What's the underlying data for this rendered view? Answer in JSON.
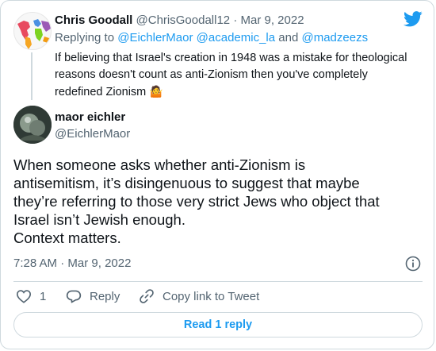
{
  "parent_tweet": {
    "author_name": "Chris Goodall",
    "author_handle": "@ChrisGoodall12",
    "separator": "·",
    "date": "Mar 9, 2022",
    "replying_prefix": "Replying to",
    "reply_to_1": "@EichlerMaor",
    "reply_to_2": "@academic_la",
    "reply_and": "and",
    "reply_to_3": "@madzeezs",
    "text_line_1": "If believing that Israel's creation in 1948 was a mistake for theological",
    "text_line_2": "reasons doesn't count as anti-Zionism then you've completely",
    "text_line_3": "redefined Zionism",
    "emoji": "🤷",
    "emoji_icon": "person-shrugging-icon"
  },
  "main_tweet": {
    "author_name": "maor eichler",
    "author_handle": "@EichlerMaor",
    "text_lines": [
      "When someone asks whether anti-Zionism is",
      "antisemitism, it’s disingenuous to suggest that maybe",
      "they’re referring to those very strict Jews who object that",
      "Israel isn’t Jewish enough.",
      "Context matters."
    ],
    "time": "7:28 AM",
    "separator": "·",
    "date": "Mar 9, 2022"
  },
  "actions": {
    "like_count": "1",
    "reply_label": "Reply",
    "copy_link_label": "Copy link to Tweet"
  },
  "read_replies_label": "Read 1 reply",
  "colors": {
    "twitter_blue": "#1d9bf0",
    "muted_text": "#536471",
    "border": "#cfd9de"
  },
  "icons": {
    "logo": "twitter-bird-icon",
    "info": "info-icon",
    "like": "heart-icon",
    "reply": "reply-bubble-icon",
    "copy": "link-icon"
  }
}
